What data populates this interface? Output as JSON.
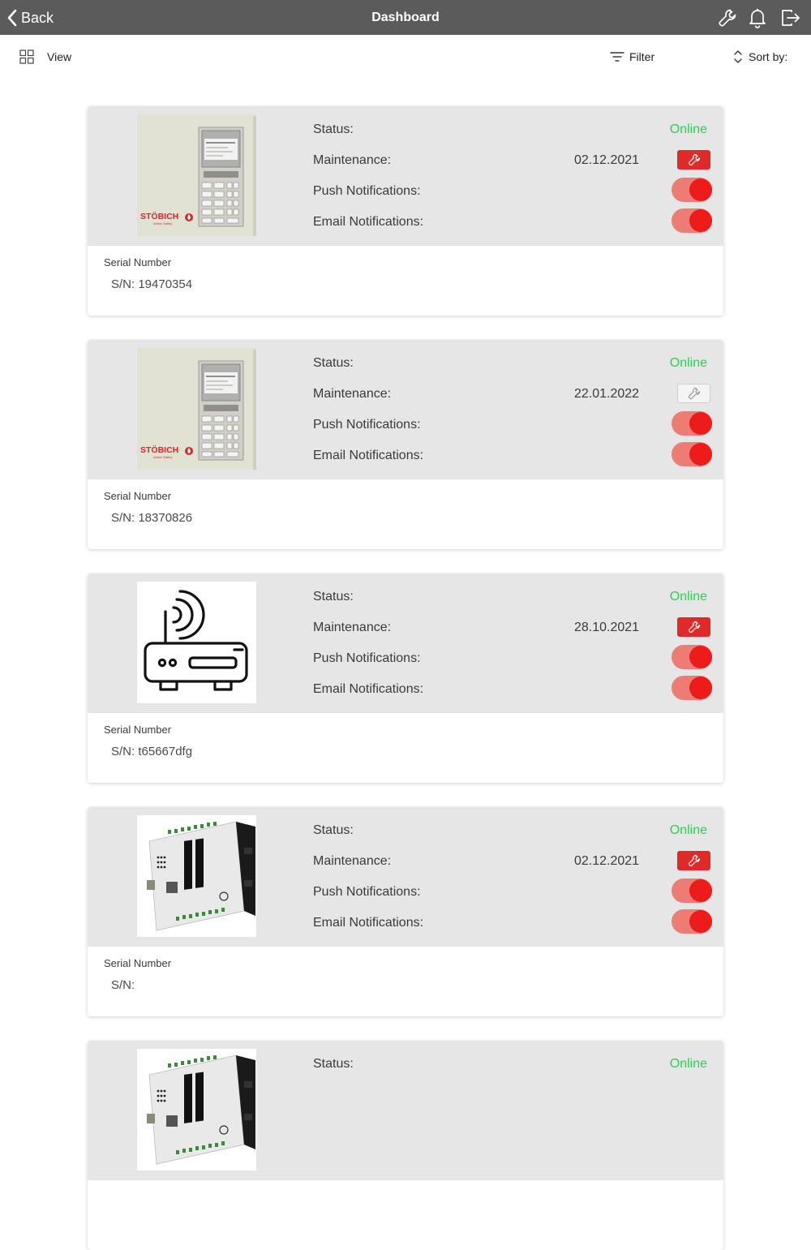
{
  "nav": {
    "back_label": "Back",
    "title": "Dashboard",
    "icons": [
      "wrench-icon",
      "bell-icon",
      "logout-icon"
    ]
  },
  "toolbar": {
    "view_label": "View",
    "filter_label": "Filter",
    "sort_label": "Sort by:"
  },
  "labels": {
    "status": "Status:",
    "maintenance": "Maintenance:",
    "push": "Push Notifications:",
    "email": "Email Notifications:",
    "serial": "Serial Number"
  },
  "colors": {
    "nav_bg": "#5b5b5b",
    "online": "#2ecc56",
    "accent_red": "#e02a2a",
    "card_top": "#e6e6e6"
  },
  "devices": [
    {
      "image": "stobich-panel",
      "brand": "STÖBICH",
      "brand_sub": "Active Safety",
      "status": "Online",
      "maintenance_date": "02.12.2021",
      "maintenance_active": true,
      "push": true,
      "email": true,
      "serial": "S/N: 19470354"
    },
    {
      "image": "stobich-panel",
      "brand": "STÖBICH",
      "brand_sub": "Active Safety",
      "status": "Online",
      "maintenance_date": "22.01.2022",
      "maintenance_active": false,
      "push": true,
      "email": true,
      "serial": "S/N: 18370826"
    },
    {
      "image": "router-icon",
      "status": "Online",
      "maintenance_date": "28.10.2021",
      "maintenance_active": true,
      "push": true,
      "email": true,
      "serial": "S/N: t65667dfg"
    },
    {
      "image": "plc-module",
      "status": "Online",
      "maintenance_date": "02.12.2021",
      "maintenance_active": true,
      "push": true,
      "email": true,
      "serial": "S/N:"
    },
    {
      "image": "plc-module",
      "status": "Online"
    }
  ]
}
